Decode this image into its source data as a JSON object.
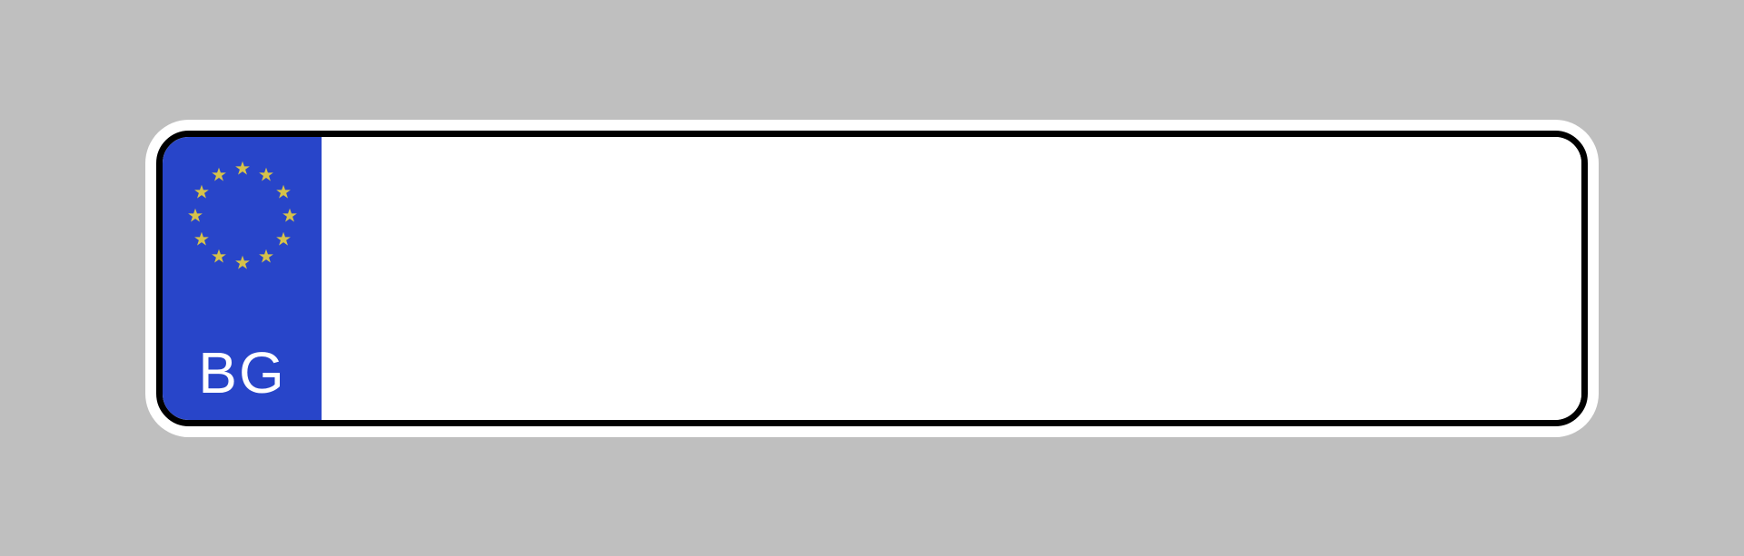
{
  "plate": {
    "country_code": "BG",
    "registration": "",
    "colors": {
      "background": "#bfbfbf",
      "plate_face": "#ffffff",
      "plate_border": "#000000",
      "eu_band": "#2845c9",
      "star": "#d6c24a",
      "country_text": "#ffffff"
    },
    "stars_count": 12
  }
}
